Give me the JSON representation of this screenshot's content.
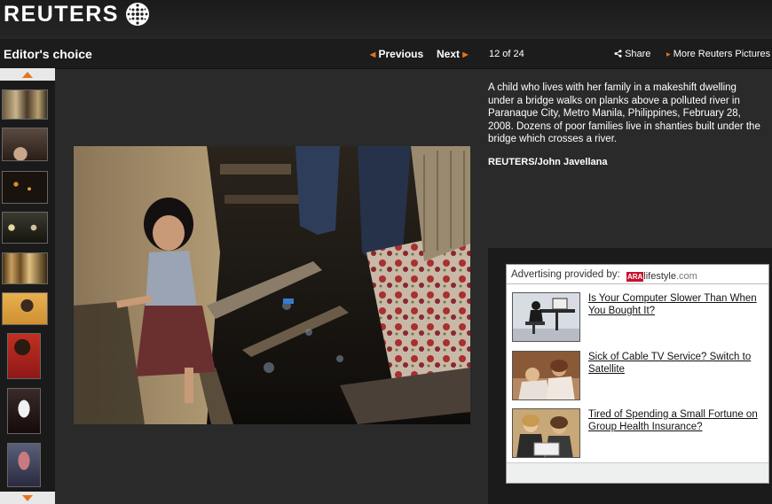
{
  "header": {
    "logo_text": "REUTERS",
    "logo_icon": "reuters-dot-globe-icon"
  },
  "nav": {
    "section_title": "Editor's choice",
    "previous_label": "Previous",
    "next_label": "Next",
    "counter": "12 of 24",
    "share_label": "Share",
    "more_label": "More Reuters Pictures",
    "accent_color": "#e8741c"
  },
  "photo": {
    "caption": "A child who lives with her family in a makeshift dwelling under a bridge walks on planks above a polluted river in Paranaque City, Metro Manila, Philippines, February 28, 2008. Dozens of poor families live in shanties built under the bridge which crosses a river.",
    "credit": "REUTERS/John Javellana"
  },
  "ads": {
    "header_text": "Advertising provided by:",
    "brand_ara": "ARA",
    "brand_rest": "lifestyle",
    "brand_tld": ".com",
    "items": [
      {
        "label": "Is Your Computer Slower Than When You Bought It?"
      },
      {
        "label": "Sick of Cable TV Service? Switch to Satellite"
      },
      {
        "label": "Tired of Spending a Small Fortune on Group Health Insurance?"
      }
    ]
  }
}
